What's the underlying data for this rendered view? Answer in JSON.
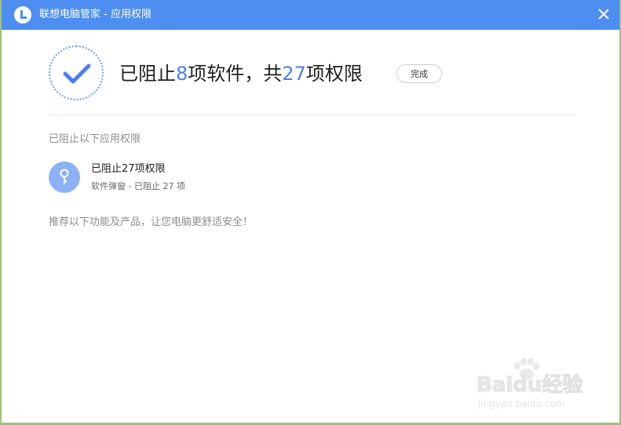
{
  "window": {
    "title": "联想电脑管家 - 应用权限"
  },
  "summary": {
    "prefix": "已阻止",
    "app_count": "8",
    "middle": "项软件，共",
    "permission_count": "27",
    "suffix": "项权限",
    "done_label": "完成"
  },
  "section": {
    "title": "已阻止以下应用权限"
  },
  "blocked_item": {
    "title": "已阻止27项权限",
    "subtitle": "软件弹窗 - 已阻止 27 项"
  },
  "recommend": {
    "text": "推荐以下功能及产品，让您电脑更舒适安全！"
  },
  "watermark": {
    "brand": "Baidu经验",
    "url": "jingyan.baidu.com"
  },
  "colors": {
    "titlebar": "#4d8ef0",
    "accent_number": "#4b7ef0",
    "icon_bg": "#8db1f7"
  },
  "icons": {
    "logo": "lenovo-l-logo-icon",
    "close": "close-icon",
    "check": "checkmark-icon",
    "item": "key-icon",
    "watermark": "paw-icon"
  }
}
